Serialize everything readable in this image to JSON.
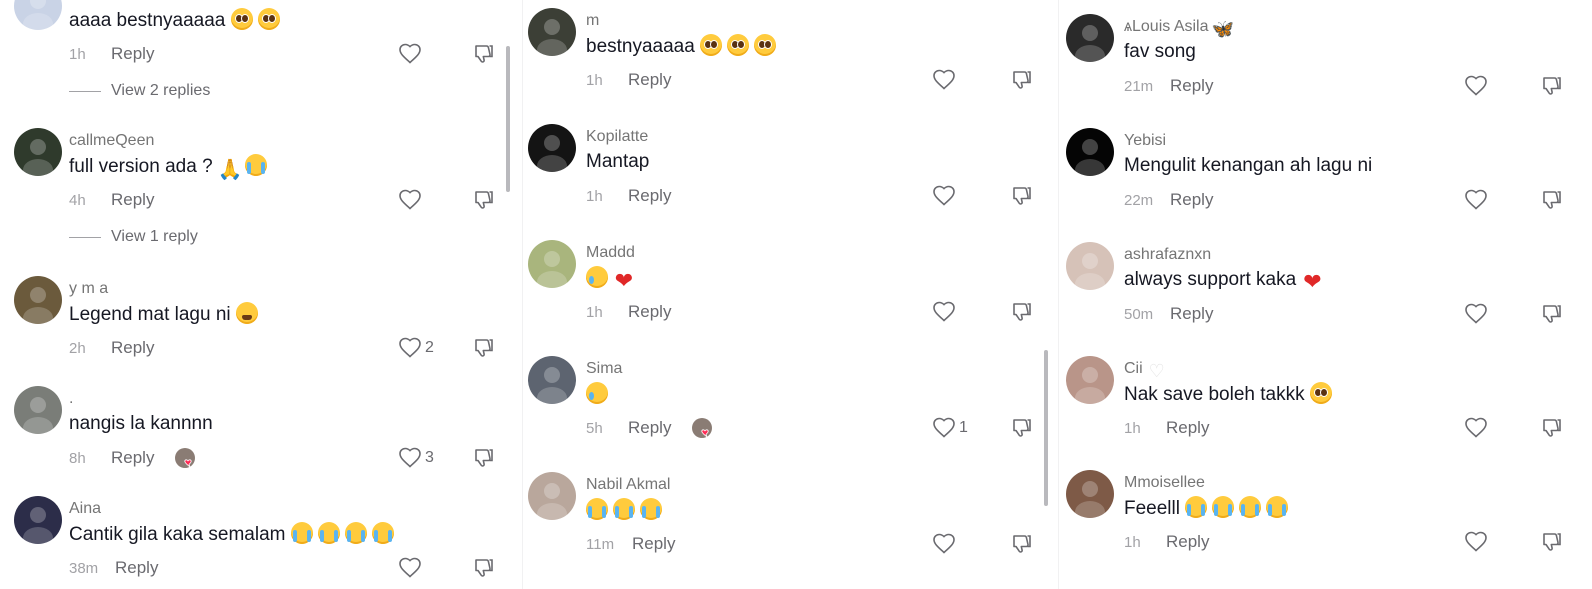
{
  "columns": [
    {
      "comments": [
        {
          "username": "",
          "text": "aaaa bestnyaaaaa",
          "emojis": [
            "pleading",
            "pleading"
          ],
          "time": "1h",
          "reply_label": "Reply",
          "like_count": "",
          "view_replies": "View 2 replies",
          "avatar_color": "#c9d3e6"
        },
        {
          "username": "callmeQeen",
          "text": "full version ada ?",
          "emojis": [
            "pray",
            "sob"
          ],
          "time": "4h",
          "reply_label": "Reply",
          "like_count": "",
          "view_replies": "View 1 reply",
          "avatar_color": "#2f3a2c"
        },
        {
          "username": "y m a",
          "text": "Legend mat lagu ni",
          "emojis": [
            "tired"
          ],
          "time": "2h",
          "reply_label": "Reply",
          "like_count": "2",
          "view_replies": "",
          "avatar_color": "#6b5a3c"
        },
        {
          "username": ".",
          "text": "nangis la kannnn",
          "emojis": [],
          "time": "8h",
          "reply_label": "Reply",
          "like_count": "3",
          "view_replies": "",
          "creator_liked": true,
          "avatar_color": "#7a7d78"
        },
        {
          "username": "Aina",
          "text": "Cantik gila kaka semalam",
          "emojis": [
            "sob",
            "sob",
            "sob",
            "sob"
          ],
          "time": "38m",
          "reply_label": "Reply",
          "like_count": "",
          "view_replies": "",
          "avatar_color": "#2c2d49"
        }
      ]
    },
    {
      "comments": [
        {
          "username": "m",
          "text": "bestnyaaaaa",
          "emojis": [
            "pleading",
            "pleading",
            "pleading"
          ],
          "time": "1h",
          "reply_label": "Reply",
          "like_count": "",
          "avatar_color": "#3c3f36"
        },
        {
          "username": "Kopilatte",
          "text": "Mantap",
          "emojis": [],
          "time": "1h",
          "reply_label": "Reply",
          "like_count": "",
          "avatar_color": "#141414"
        },
        {
          "username": "Maddd",
          "text": "",
          "emojis": [
            "cry",
            "heart"
          ],
          "time": "1h",
          "reply_label": "Reply",
          "like_count": "",
          "avatar_color": "#a9b57d"
        },
        {
          "username": "Sima",
          "text": "",
          "emojis": [
            "cry"
          ],
          "time": "5h",
          "reply_label": "Reply",
          "like_count": "1",
          "creator_liked": true,
          "avatar_color": "#5d6470"
        },
        {
          "username": "Nabil Akmal",
          "text": "",
          "emojis": [
            "sob",
            "sob",
            "sob"
          ],
          "time": "11m",
          "reply_label": "Reply",
          "like_count": "",
          "avatar_color": "#b9a79c"
        }
      ]
    },
    {
      "comments": [
        {
          "username": "ѧLouis Asila",
          "username_emoji": "butterfly",
          "text": "fav song",
          "emojis": [],
          "time": "21m",
          "reply_label": "Reply",
          "like_count": "",
          "avatar_color": "#2a2a2a"
        },
        {
          "username": "Yebisi",
          "text": "Mengulit kenangan ah lagu ni",
          "emojis": [],
          "time": "22m",
          "reply_label": "Reply",
          "like_count": "",
          "avatar_color": "#050505"
        },
        {
          "username": "ashrafaznxn",
          "text": "always support kaka",
          "emojis": [
            "heart"
          ],
          "time": "50m",
          "reply_label": "Reply",
          "like_count": "",
          "avatar_color": "#d6c2b8"
        },
        {
          "username": "Cii",
          "username_emoji": "white-heart",
          "text": "Nak save boleh takkk",
          "emojis": [
            "pleading"
          ],
          "time": "1h",
          "reply_label": "Reply",
          "like_count": "",
          "avatar_color": "#b99589"
        },
        {
          "username": "Mmoisellee",
          "text": "Feeelll",
          "emojis": [
            "sob",
            "sob",
            "sob",
            "sob"
          ],
          "time": "1h",
          "reply_label": "Reply",
          "like_count": "",
          "avatar_color": "#7e5a47"
        }
      ]
    }
  ],
  "colors": {
    "text": "#161823",
    "secondary": "#757575",
    "muted": "#a2a2a6",
    "heart": "#fe2c55"
  }
}
